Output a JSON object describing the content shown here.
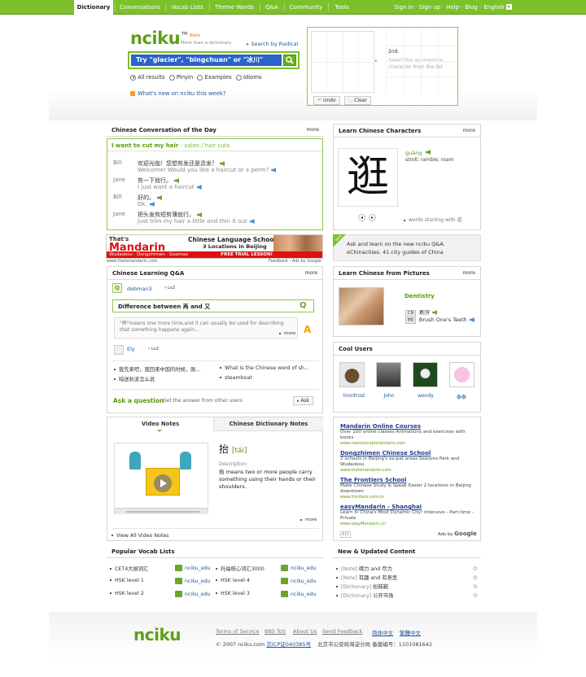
{
  "nav": {
    "tabs": [
      "Dictionary",
      "Conversations",
      "Vocab Lists",
      "Theme Words",
      "Q&A",
      "Community",
      "Tools"
    ],
    "right": [
      "Sign in",
      "Sign up",
      "Help",
      "Blog",
      "English"
    ]
  },
  "search": {
    "logo": "nciku",
    "tm": "TM",
    "beta": "Beta",
    "tagline": "More than a dictionary",
    "radical": "Search by Radical",
    "value": "Try \"glacier\", \"bingchuan\" or \"冰川\"",
    "options": [
      "All results",
      "Pinyin",
      "Examples",
      "Idioms"
    ],
    "whatsnew": "What's new on nciku this week?"
  },
  "handwriting": {
    "label": "2nd.",
    "hint": "Select the appropriate character from the list",
    "undo": "Undo",
    "clear": "Clear"
  },
  "conversation": {
    "title": "Chinese Conversation of the Day",
    "more": "more",
    "topic": "I want to cut my hair",
    "topic_sub": " - salon / hair cuts",
    "lines": [
      {
        "speaker": "Bill",
        "zh": "欢迎光临！您想剪发还是烫发？",
        "en": "Welcome! Would you like a haircut or a perm?"
      },
      {
        "speaker": "Jane",
        "zh": "剪一下就行。",
        "en": "I just want a haircut"
      },
      {
        "speaker": "Bill",
        "zh": "好的。",
        "en": "Ok."
      },
      {
        "speaker": "Jane",
        "zh": "把头发剪短剪薄就行。",
        "en": "Just trim my hair a little and thin it out"
      }
    ]
  },
  "learn_chars": {
    "title": "Learn Chinese Characters",
    "more": "more",
    "char": "逛",
    "pinyin": "guàng",
    "meaning": "stroll; ramble; roam",
    "words": "words starting with 逛"
  },
  "ad_banner": {
    "brand_top": "That's",
    "brand": "Mandarin",
    "headline": "Chinese Language School",
    "sub": "3 Locations in Beijing",
    "locations": "Wudaokou · Dongzhimen · Guomao",
    "cta": "FREE TRIAL LESSON!",
    "url": "www.thatsmandarin.com",
    "feedback": "Feedback - Ads by Google"
  },
  "qa_promo": {
    "badge": "NEW",
    "line1": "Ask and learn on the new nciku Q&A.",
    "line2": "eChinacities: 41 city guides of China"
  },
  "qa": {
    "title": "Chinese Learning Q&A",
    "more": "more",
    "user": "debman3",
    "level": "Lv2",
    "question": "Difference between 再 and 又",
    "answer": "\"再\"means one more time,and it can usually be used for describing that something happens again...",
    "answer_more": "more",
    "answer_user": "Ely",
    "answer_level": "Lv2",
    "links": [
      "我先来吧，我回来中国的时候，刚...",
      "What is the Chinese word of sh...",
      "暗送秋波怎么说",
      "steamboat"
    ],
    "ask": "Ask a question",
    "ask_sub": "Get the answer from other users",
    "ask_btn": "Ask"
  },
  "pictures": {
    "title": "Learn Chinese from Pictures",
    "more": "more",
    "topic": "Dentistry",
    "cn_tag": "CN",
    "cn": "刷牙",
    "en_tag": "EN",
    "en": "Brush One's Teeth"
  },
  "cool_users": {
    "title": "Cool Users",
    "users": [
      "lironfrost",
      "John",
      "wendy",
      "泰泰"
    ]
  },
  "video": {
    "tab1": "Video Notes",
    "tab2": "Chinese Dictionary Notes",
    "char": "抬",
    "pinyin": "[tái]",
    "desc_label": "Description",
    "desc": "抬 means two or more people carry something using their hands or their shoulders.",
    "more": "more",
    "view_all": "View All Video Notes"
  },
  "google_ads": [
    {
      "title": "Mandarin Online Courses",
      "text": "Over 100 online classes Animations and exercises with books",
      "url": "www.newconceptmandarin.com"
    },
    {
      "title": "Dongzhimen Chinese School",
      "text": "2 schools in Beijing's ex-pat areas Seasons Park and Wudaokou",
      "url": "www.thatsmandarin.com"
    },
    {
      "title": "The Frontiers School",
      "text": "Make Chinese Study & Speak Easier 2 locations in Beijing downtown",
      "url": "www.frontiers.com.cn"
    },
    {
      "title": "easyMandarin - Shanghai",
      "text": "Learn in China's Most Dynamic City! Intensive - Part-time - Private",
      "url": "www.easyMandarin.cn"
    }
  ],
  "ads_by": "Ads by",
  "google": "Google",
  "ad_corner": "A|V",
  "vocab": {
    "title": "Popular Vocab Lists",
    "items": [
      {
        "name": "CET4大纲词汇",
        "user": "nciku_edu"
      },
      {
        "name": "托福核心词汇3000",
        "user": "nciku_edu"
      },
      {
        "name": "HSK level 1",
        "user": "nciku_edu"
      },
      {
        "name": "HSK level 4",
        "user": "nciku_edu"
      },
      {
        "name": "HSK level 2",
        "user": "nciku_edu"
      },
      {
        "name": "HSK level 3",
        "user": "nciku_edu"
      }
    ]
  },
  "updates": {
    "title": "New & Updated Content",
    "items": [
      {
        "tag": "[Note]",
        "text": "竭力 and 尽力"
      },
      {
        "tag": "[Note]",
        "text": "有趣 and 有意思"
      },
      {
        "tag": "[Dictionary]",
        "text": "松糕鞋"
      },
      {
        "tag": "[Dictionary]",
        "text": "公开市场"
      }
    ]
  },
  "footer": {
    "logo": "nciku",
    "links": [
      "Terms of Service",
      "BBS ToS",
      "About Us",
      "Send Feedback"
    ],
    "langs": [
      "简体中文",
      "繁體中文"
    ],
    "copy": "© 2007 nciku.com",
    "icp": "京ICP证040385号",
    "police": "北京市公安局海淀分局 备案编号：1101081642"
  },
  "colors": {
    "nav": "#7cc02c",
    "accent": "#5c9a0e",
    "link": "#24569c"
  }
}
